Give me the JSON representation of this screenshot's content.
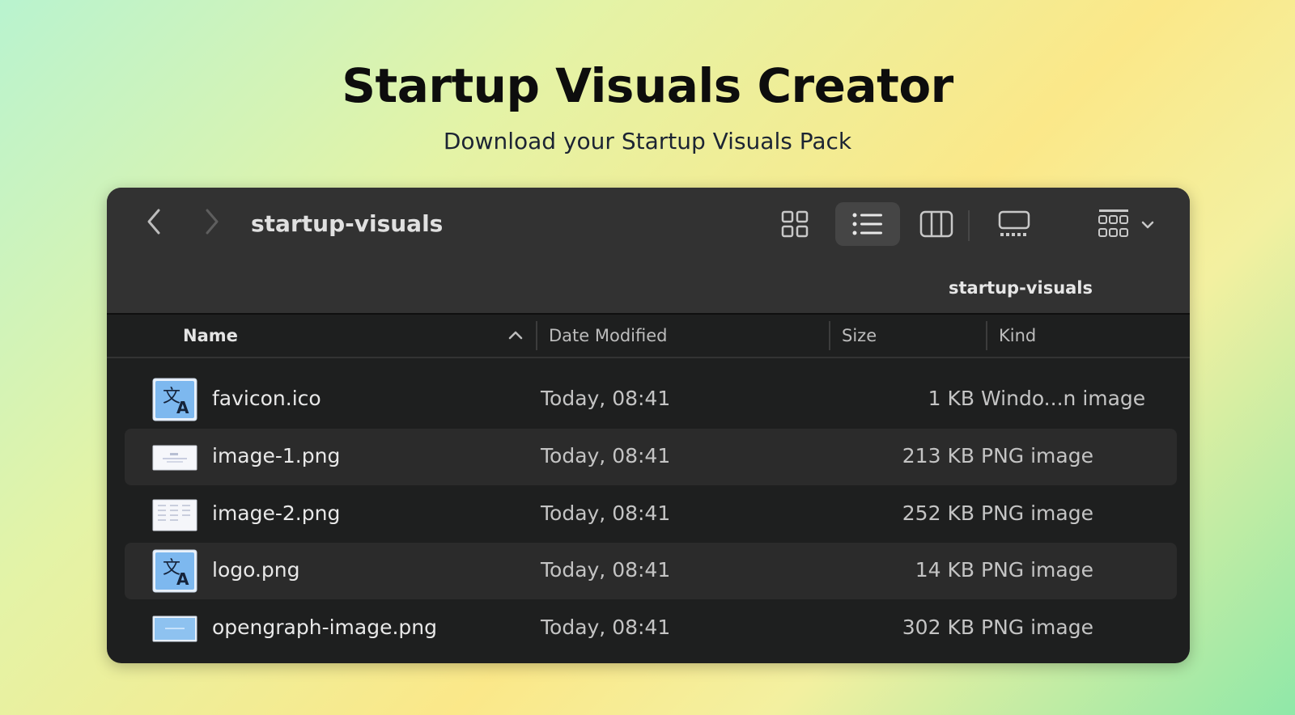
{
  "hero": {
    "title": "Startup Visuals Creator",
    "subtitle": "Download your Startup Visuals Pack"
  },
  "window": {
    "title": "startup-visuals",
    "path_label": "startup-visuals"
  },
  "columns": {
    "name": "Name",
    "date": "Date Modified",
    "size": "Size",
    "kind": "Kind"
  },
  "files": [
    {
      "name": "favicon.ico",
      "date": "Today, 08:41",
      "size": "1 KB",
      "kind": "Windo...n image",
      "icon": "translate-app-icon"
    },
    {
      "name": "image-1.png",
      "date": "Today, 08:41",
      "size": "213 KB",
      "kind": "PNG image",
      "icon": "image-thumbnail-icon"
    },
    {
      "name": "image-2.png",
      "date": "Today, 08:41",
      "size": "252 KB",
      "kind": "PNG image",
      "icon": "image-thumbnail-icon"
    },
    {
      "name": "logo.png",
      "date": "Today, 08:41",
      "size": "14 KB",
      "kind": "PNG image",
      "icon": "translate-app-icon"
    },
    {
      "name": "opengraph-image.png",
      "date": "Today, 08:41",
      "size": "302 KB",
      "kind": "PNG image",
      "icon": "blue-image-thumbnail-icon"
    }
  ],
  "colors": {
    "window_bg": "#1e1f1f",
    "toolbar_bg": "#323232",
    "row_stripe": "#2b2b2b",
    "selected_view_bg": "#454545"
  }
}
